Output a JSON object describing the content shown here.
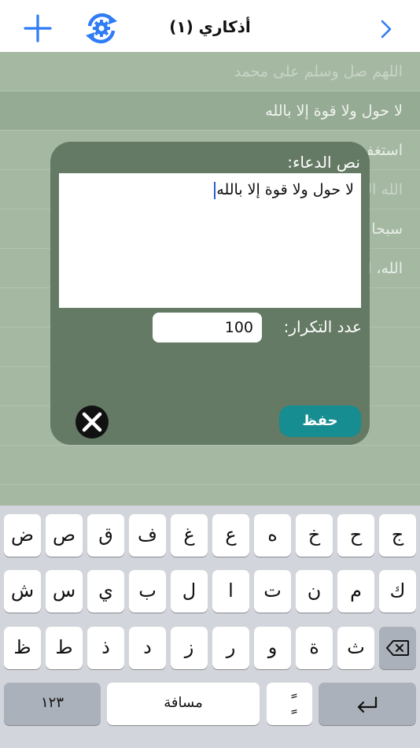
{
  "navbar": {
    "title": "أذكاري (١)",
    "plus_icon": "plus-icon",
    "refresh_icon": "refresh-gear-icon",
    "chevron_icon": "chevron-right-icon",
    "accent_color": "#2e7cf6"
  },
  "list": {
    "items": [
      {
        "label": "اللهم صل وسلم على محمد"
      },
      {
        "label": "لا حول ولا قوة إلا بالله"
      },
      {
        "label": "استغفر"
      },
      {
        "label": "الله اك"
      },
      {
        "label": "سبحا"
      },
      {
        "label": "الله، ا"
      }
    ]
  },
  "dialog": {
    "text_label": "نص الدعاء:",
    "text_value": "لا حول ولا قوة إلا بالله",
    "count_label": "عدد التكرار:",
    "count_value": "100",
    "save_label": "حفظ",
    "close_icon": "close-circle-icon",
    "save_color": "#168d90"
  },
  "keyboard": {
    "row1": [
      "ض",
      "ص",
      "ق",
      "ف",
      "غ",
      "ع",
      "ه",
      "خ",
      "ح",
      "ج"
    ],
    "row2": [
      "ش",
      "س",
      "ي",
      "ب",
      "ل",
      "ا",
      "ت",
      "ن",
      "م",
      "ك"
    ],
    "row3": [
      "ظ",
      "ط",
      "ذ",
      "د",
      "ز",
      "ر",
      "و",
      "ة",
      "ث"
    ],
    "delete_icon": "backspace-icon",
    "numbers_label": "١٢٣",
    "space_label": "مسافة",
    "diacritic_label": "ًٍ",
    "return_icon": "return-icon"
  }
}
